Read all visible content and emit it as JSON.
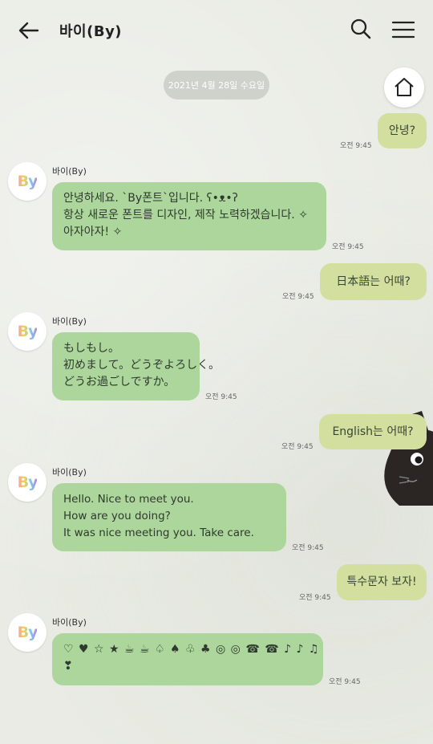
{
  "header": {
    "title": "바이(By)"
  },
  "date_divider": "2021년 4월 28일 수요일",
  "sender_name": "바이(By)",
  "avatar_text": "By",
  "messages": [
    {
      "type": "sent",
      "text": "안녕?",
      "time": "오전 9:45"
    },
    {
      "type": "recv",
      "lines": [
        "안녕하세요. `By폰트`입니다. ʕ•ᴥ•ʔ",
        "항상 새로운 폰트를 디자인, 제작 노력하겠습니다. ✧",
        "아자아자! ✧"
      ],
      "time": "오전 9:45"
    },
    {
      "type": "sent",
      "text": "日本語는 어때?",
      "time": "오전 9:45"
    },
    {
      "type": "recv",
      "lines": [
        "もしもし。",
        "初めまして。どうぞよろしく。",
        "どうお過ごしですか。"
      ],
      "time": "오전 9:45"
    },
    {
      "type": "sent",
      "text": "English는 어때?",
      "time": "오전 9:45"
    },
    {
      "type": "recv",
      "lines": [
        "Hello. Nice to meet you.",
        "How are you doing?",
        "It was nice meeting you. Take care."
      ],
      "time": "오전 9:45"
    },
    {
      "type": "sent",
      "text": "특수문자 보자!",
      "time": "오전 9:45"
    },
    {
      "type": "recv",
      "lines": [
        "♡ ♥ ☆ ★ ☕ ☕ ♤ ♠ ♧ ♣ ◎ ◎ ☎ ☎ ♪ ♪ ♫",
        "❣"
      ],
      "time": "오전 9:45"
    }
  ],
  "colors": {
    "sent_bubble": "#d3df9f",
    "recv_bubble": "#acd69b",
    "background": "#e9ebe4"
  }
}
